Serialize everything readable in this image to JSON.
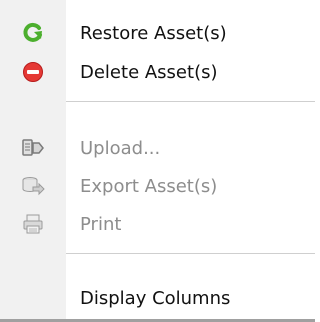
{
  "menu": {
    "items": [
      {
        "label": "Restore Asset(s)",
        "icon": "restore-icon",
        "enabled": true
      },
      {
        "label": "Delete Asset(s)",
        "icon": "delete-icon",
        "enabled": true
      },
      {
        "label": "Upload...",
        "icon": "upload-icon",
        "enabled": false
      },
      {
        "label": "Export Asset(s)",
        "icon": "export-icon",
        "enabled": false
      },
      {
        "label": "Print",
        "icon": "print-icon",
        "enabled": false
      },
      {
        "label": "Display Columns",
        "icon": "",
        "enabled": true
      }
    ],
    "colors": {
      "restore_icon": "#4caf2e",
      "delete_icon": "#e53935",
      "enabled_text": "#111111",
      "disabled_text": "#8d8d8d"
    }
  }
}
